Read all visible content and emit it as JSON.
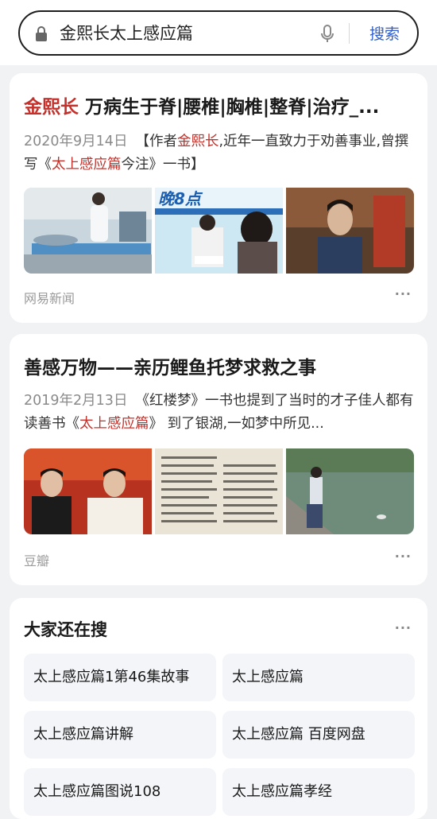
{
  "search": {
    "query": "金熙长太上感应篇",
    "button": "搜索"
  },
  "results": [
    {
      "title_hl": "金熙长",
      "title_rest": " 万病生于脊|腰椎|胸椎|整脊|治疗_...",
      "date": "2020年9月14日",
      "snippet_a": "【作者",
      "snippet_hl1": "金熙长",
      "snippet_b": ",近年一直致力于劝善事业,曾撰写《",
      "snippet_hl2": "太上感应篇",
      "snippet_c": "今注》一书】",
      "source": "网易新闻",
      "more": "···"
    },
    {
      "title": "善感万物——亲历鲤鱼托梦求救之事",
      "date": "2019年2月13日",
      "snippet_a": "《红楼梦》一书也提到了当时的才子佳人都有读善书《",
      "snippet_hl": "太上感应篇",
      "snippet_b": "》 到了银湖,一如梦中所见...",
      "source": "豆瓣",
      "more": "···"
    }
  ],
  "related": {
    "title": "大家还在搜",
    "more": "···",
    "items": [
      "太上感应篇1第46集故事",
      "太上感应篇",
      "太上感应篇讲解",
      "太上感应篇 百度网盘",
      "太上感应篇图说108",
      "太上感应篇孝经"
    ]
  },
  "image_texts": {
    "newspaper": "晚8点"
  },
  "colors": {
    "highlight": "#c5312a",
    "link_blue": "#2f5fcf"
  }
}
